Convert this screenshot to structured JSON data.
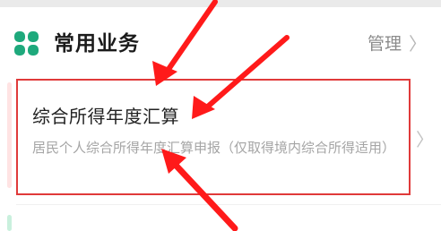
{
  "section": {
    "title": "常用业务",
    "manage_label": "管理",
    "chevron_glyph": "〉",
    "icon": "grid-four-dots-icon"
  },
  "item": {
    "title": "综合所得年度汇算",
    "description": "居民个人综合所得年度汇算申报（仅取得境内综合所得适用）",
    "chevron_glyph": "〉"
  },
  "colors": {
    "accent_green": "#1ea97c",
    "highlight_red": "#e03a3a"
  }
}
